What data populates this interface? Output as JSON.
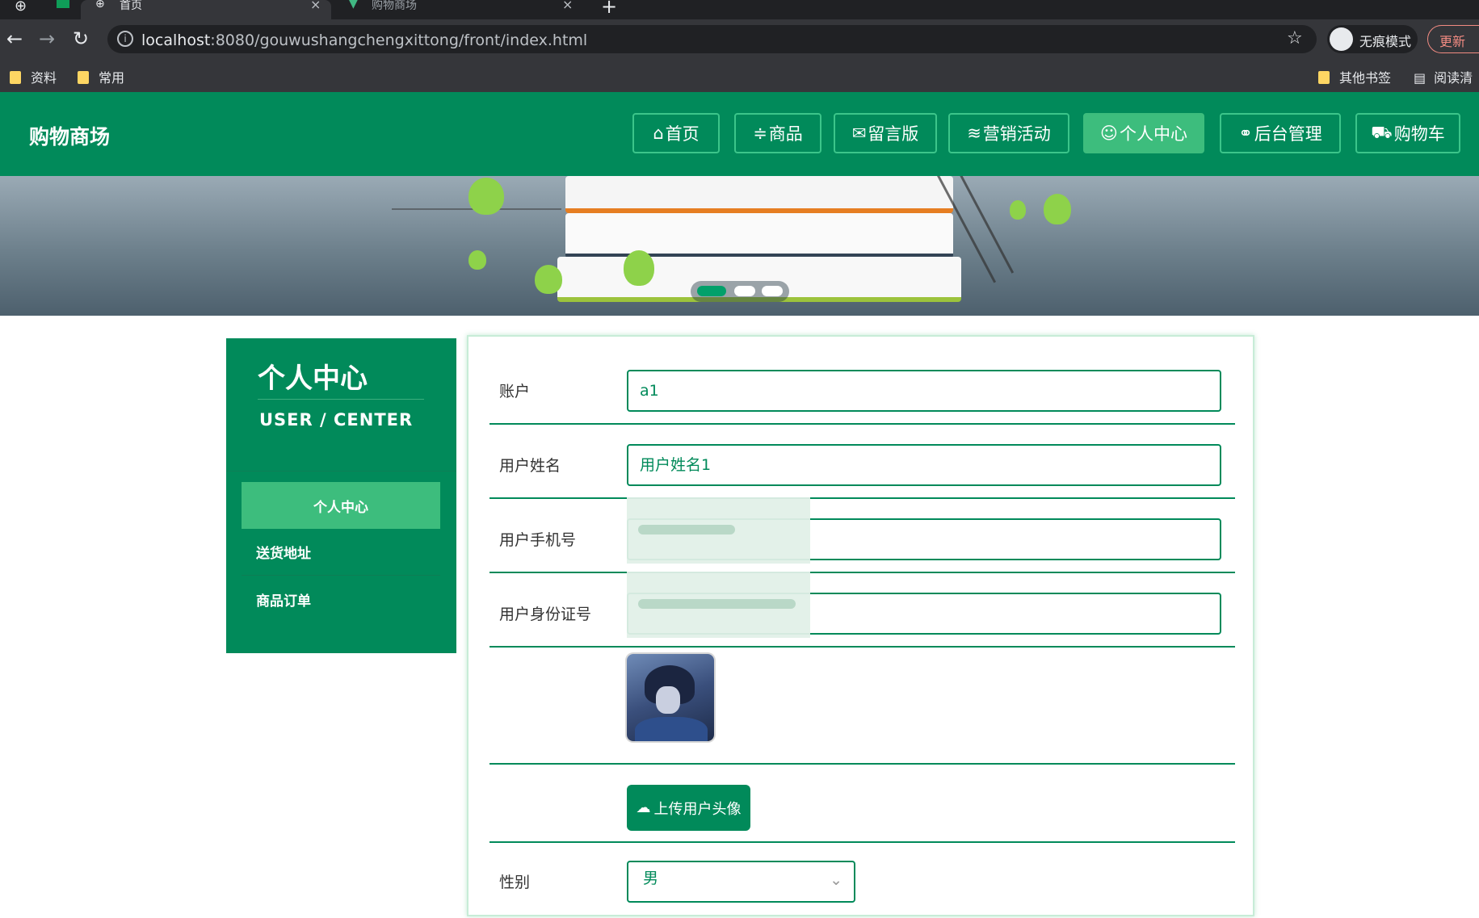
{
  "browser": {
    "tabs": [
      {
        "title": "首页",
        "active": true
      },
      {
        "title": "购物商场",
        "active": false
      }
    ],
    "new_tab": "+",
    "close": "×",
    "url_host": "localhost",
    "url_path": ":8080/gouwushangchengxittong/front/index.html",
    "incognito_label": "无痕模式",
    "update_label": "更新",
    "bookmarks": [
      "资料",
      "常用"
    ],
    "other_bookmarks": "其他书签",
    "reading_list": "阅读清"
  },
  "header": {
    "brand": "购物商场",
    "nav": [
      {
        "icon": "⌂",
        "label": "首页"
      },
      {
        "icon": "≑",
        "label": "商品"
      },
      {
        "icon": "✉",
        "label": "留言版"
      },
      {
        "icon": "≋",
        "label": "营销活动"
      },
      {
        "icon": "☺",
        "label": "个人中心",
        "active": true
      },
      {
        "icon": "⚭",
        "label": "后台管理"
      },
      {
        "icon": "⛟",
        "label": "购物车"
      }
    ]
  },
  "banner": {
    "active_slide": 1,
    "slide_count": 3
  },
  "sidebar": {
    "title": "个人中心",
    "subtitle": "USER / CENTER",
    "items": [
      {
        "label": "个人中心",
        "active": true
      },
      {
        "label": "送货地址"
      },
      {
        "label": "商品订单"
      }
    ]
  },
  "form": {
    "account": {
      "label": "账户",
      "value": "a1"
    },
    "name": {
      "label": "用户姓名",
      "value": "用户姓名1"
    },
    "phone": {
      "label": "用户手机号",
      "value": ""
    },
    "id_number": {
      "label": "用户身份证号",
      "value": ""
    },
    "upload_label": "上传用户头像",
    "gender": {
      "label": "性别",
      "value": "男"
    }
  },
  "colors": {
    "primary": "#018a5a",
    "accent": "#3dbd7d",
    "chrome": "#202124"
  }
}
